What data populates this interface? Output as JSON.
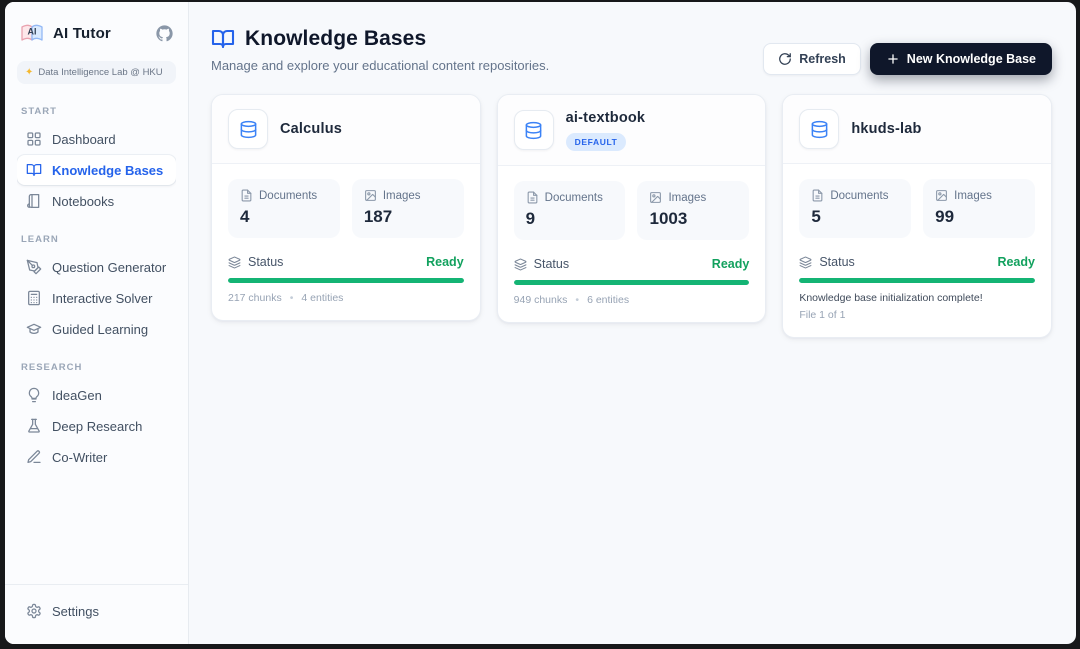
{
  "app": {
    "title": "AI Tutor",
    "lab_badge": "Data Intelligence Lab @ HKU",
    "settings_label": "Settings"
  },
  "sidebar": {
    "sections": [
      {
        "label": "START",
        "items": [
          {
            "label": "Dashboard",
            "icon": "dashboard-icon",
            "active": false
          },
          {
            "label": "Knowledge Bases",
            "icon": "book-open-icon",
            "active": true
          },
          {
            "label": "Notebooks",
            "icon": "notebook-icon",
            "active": false
          }
        ]
      },
      {
        "label": "LEARN",
        "items": [
          {
            "label": "Question Generator",
            "icon": "pen-nib-icon",
            "active": false
          },
          {
            "label": "Interactive Solver",
            "icon": "calculator-icon",
            "active": false
          },
          {
            "label": "Guided Learning",
            "icon": "graduation-cap-icon",
            "active": false
          }
        ]
      },
      {
        "label": "RESEARCH",
        "items": [
          {
            "label": "IdeaGen",
            "icon": "lightbulb-icon",
            "active": false
          },
          {
            "label": "Deep Research",
            "icon": "flask-icon",
            "active": false
          },
          {
            "label": "Co-Writer",
            "icon": "pencil-icon",
            "active": false
          }
        ]
      }
    ]
  },
  "header": {
    "title": "Knowledge Bases",
    "subtitle": "Manage and explore your educational content repositories.",
    "refresh_label": "Refresh",
    "new_kb_label": "New Knowledge Base"
  },
  "cards": [
    {
      "title": "Calculus",
      "documents_label": "Documents",
      "documents_value": "4",
      "images_label": "Images",
      "images_value": "187",
      "status_label": "Status",
      "status_value": "Ready",
      "progress_pct": 100,
      "chunks": "217 chunks",
      "entities": "4 entities"
    },
    {
      "title": "ai-textbook",
      "badge": "DEFAULT",
      "documents_label": "Documents",
      "documents_value": "9",
      "images_label": "Images",
      "images_value": "1003",
      "status_label": "Status",
      "status_value": "Ready",
      "progress_pct": 100,
      "chunks": "949 chunks",
      "entities": "6 entities"
    },
    {
      "title": "hkuds-lab",
      "documents_label": "Documents",
      "documents_value": "5",
      "images_label": "Images",
      "images_value": "99",
      "status_label": "Status",
      "status_value": "Ready",
      "progress_pct": 100,
      "message": "Knowledge base initialization complete!",
      "submessage": "File 1 of 1"
    }
  ],
  "colors": {
    "accent_blue": "#2563eb",
    "success_green": "#14b474",
    "dark_button_bg": "#0f172a",
    "default_badge_bg": "#dbeafe",
    "sidebar_bg": "#fbfcfe",
    "main_bg": "#f7f9fc"
  }
}
